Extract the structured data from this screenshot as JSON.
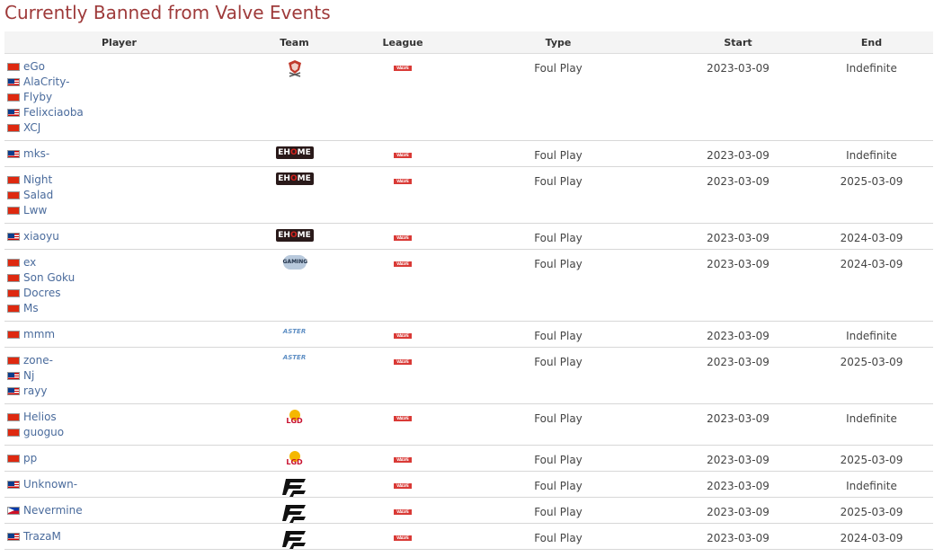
{
  "page": {
    "title": "Currently Banned from Valve Events"
  },
  "headers": {
    "player": "Player",
    "team": "Team",
    "league": "League",
    "type": "Type",
    "start": "Start",
    "end": "End"
  },
  "rows": [
    {
      "players": [
        {
          "name": "eGo",
          "flag": "cn"
        },
        {
          "name": "AlaCrity-",
          "flag": "my"
        },
        {
          "name": "Flyby",
          "flag": "cn"
        },
        {
          "name": "Felixciaoba",
          "flag": "my"
        },
        {
          "name": "XCJ",
          "flag": "cn"
        }
      ],
      "team": "emblem-team-logo",
      "league": "VALVE",
      "type": "Foul Play",
      "start": "2023-03-09",
      "end": "Indefinite"
    },
    {
      "players": [
        {
          "name": "mks-",
          "flag": "my"
        }
      ],
      "team": "ehome-logo",
      "league": "VALVE",
      "type": "Foul Play",
      "start": "2023-03-09",
      "end": "Indefinite"
    },
    {
      "players": [
        {
          "name": "Night",
          "flag": "cn"
        },
        {
          "name": "Salad",
          "flag": "cn"
        },
        {
          "name": "Lww",
          "flag": "cn"
        }
      ],
      "team": "ehome-logo",
      "league": "VALVE",
      "type": "Foul Play",
      "start": "2023-03-09",
      "end": "2025-03-09"
    },
    {
      "players": [
        {
          "name": "xiaoyu",
          "flag": "my"
        }
      ],
      "team": "ehome-logo",
      "league": "VALVE",
      "type": "Foul Play",
      "start": "2023-03-09",
      "end": "2024-03-09"
    },
    {
      "players": [
        {
          "name": "ex",
          "flag": "cn"
        },
        {
          "name": "Son Goku",
          "flag": "cn"
        },
        {
          "name": "Docres",
          "flag": "cn"
        },
        {
          "name": "Ms",
          "flag": "cn"
        }
      ],
      "team": "gaming-logo",
      "league": "VALVE",
      "type": "Foul Play",
      "start": "2023-03-09",
      "end": "2024-03-09"
    },
    {
      "players": [
        {
          "name": "mmm",
          "flag": "cn"
        }
      ],
      "team": "aster-logo",
      "league": "VALVE",
      "type": "Foul Play",
      "start": "2023-03-09",
      "end": "Indefinite"
    },
    {
      "players": [
        {
          "name": "zone-",
          "flag": "cn"
        },
        {
          "name": "Nj",
          "flag": "my"
        },
        {
          "name": "rayy",
          "flag": "my"
        }
      ],
      "team": "aster-logo",
      "league": "VALVE",
      "type": "Foul Play",
      "start": "2023-03-09",
      "end": "2025-03-09"
    },
    {
      "players": [
        {
          "name": "Helios",
          "flag": "cn"
        },
        {
          "name": "guoguo",
          "flag": "cn"
        }
      ],
      "team": "lgd-logo",
      "league": "VALVE",
      "type": "Foul Play",
      "start": "2023-03-09",
      "end": "Indefinite"
    },
    {
      "players": [
        {
          "name": "pp",
          "flag": "cn"
        }
      ],
      "team": "lgd-logo",
      "league": "VALVE",
      "type": "Foul Play",
      "start": "2023-03-09",
      "end": "2025-03-09"
    },
    {
      "players": [
        {
          "name": "Unknown-",
          "flag": "my"
        }
      ],
      "team": "ff-logo",
      "league": "VALVE",
      "type": "Foul Play",
      "start": "2023-03-09",
      "end": "Indefinite"
    },
    {
      "players": [
        {
          "name": "Nevermine",
          "flag": "ph"
        }
      ],
      "team": "ff-logo",
      "league": "VALVE",
      "type": "Foul Play",
      "start": "2023-03-09",
      "end": "2025-03-09"
    },
    {
      "players": [
        {
          "name": "TrazaM",
          "flag": "my"
        }
      ],
      "team": "ff-logo",
      "league": "VALVE",
      "type": "Foul Play",
      "start": "2023-03-09",
      "end": "2024-03-09"
    }
  ]
}
